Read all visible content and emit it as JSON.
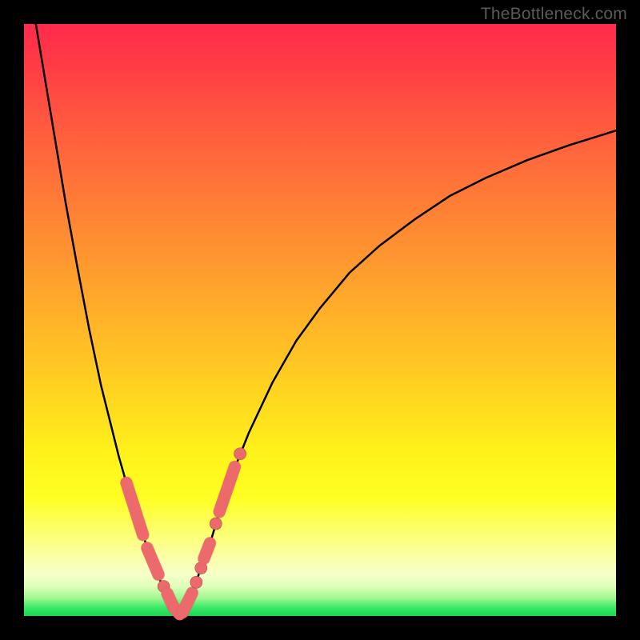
{
  "watermark": "TheBottleneck.com",
  "colors": {
    "background": "#000000",
    "curve_stroke": "#000000",
    "marker_fill": "#ec6a6b",
    "marker_stroke": "#b54748"
  },
  "chart_data": {
    "type": "line",
    "title": "",
    "xlabel": "",
    "ylabel": "",
    "xlim": [
      0,
      100
    ],
    "ylim": [
      0,
      100
    ],
    "series": [
      {
        "name": "left-branch",
        "x": [
          2.0,
          4.5,
          7.0,
          9.0,
          11.0,
          13.0,
          15.0,
          16.0,
          17.0,
          18.0,
          19.0,
          20.0,
          21.0,
          22.0,
          23.0,
          24.0,
          25.0,
          25.5,
          26.0
        ],
        "y": [
          100.0,
          85.0,
          70.0,
          59.0,
          48.5,
          39.0,
          31.0,
          27.0,
          23.5,
          20.0,
          17.0,
          14.0,
          11.0,
          8.5,
          6.0,
          4.0,
          2.5,
          1.2,
          0.0
        ]
      },
      {
        "name": "right-branch",
        "x": [
          26.0,
          27.0,
          28.0,
          29.0,
          30.0,
          31.5,
          33.0,
          35.0,
          38.0,
          42.0,
          46.0,
          50.0,
          55.0,
          60.0,
          66.0,
          72.0,
          78.0,
          85.0,
          92.0,
          100.0
        ],
        "y": [
          0.0,
          1.0,
          3.0,
          5.5,
          8.5,
          12.5,
          17.5,
          23.5,
          31.0,
          39.5,
          46.5,
          52.0,
          58.0,
          62.5,
          67.0,
          71.0,
          74.0,
          77.0,
          79.5,
          82.0
        ]
      }
    ],
    "markers": [
      {
        "shape": "pill",
        "x1": 17.3,
        "y1": 22.5,
        "x2": 20.1,
        "y2": 13.7
      },
      {
        "shape": "pill",
        "x1": 20.8,
        "y1": 11.5,
        "x2": 22.7,
        "y2": 7.0
      },
      {
        "shape": "dot",
        "x": 23.6,
        "y": 5.0
      },
      {
        "shape": "pill",
        "x1": 24.2,
        "y1": 3.8,
        "x2": 25.2,
        "y2": 1.6
      },
      {
        "shape": "pill",
        "x1": 25.4,
        "y1": 1.3,
        "x2": 26.3,
        "y2": 0.3
      },
      {
        "shape": "pill",
        "x1": 26.8,
        "y1": 0.6,
        "x2": 28.4,
        "y2": 3.9
      },
      {
        "shape": "dot",
        "x": 29.1,
        "y": 5.7
      },
      {
        "shape": "dot",
        "x": 29.9,
        "y": 8.1
      },
      {
        "shape": "pill",
        "x1": 30.4,
        "y1": 9.7,
        "x2": 31.4,
        "y2": 12.3
      },
      {
        "shape": "dot",
        "x": 32.4,
        "y": 15.6
      },
      {
        "shape": "pill",
        "x1": 33.0,
        "y1": 17.6,
        "x2": 35.6,
        "y2": 25.2
      },
      {
        "shape": "dot",
        "x": 36.5,
        "y": 27.4
      }
    ]
  }
}
